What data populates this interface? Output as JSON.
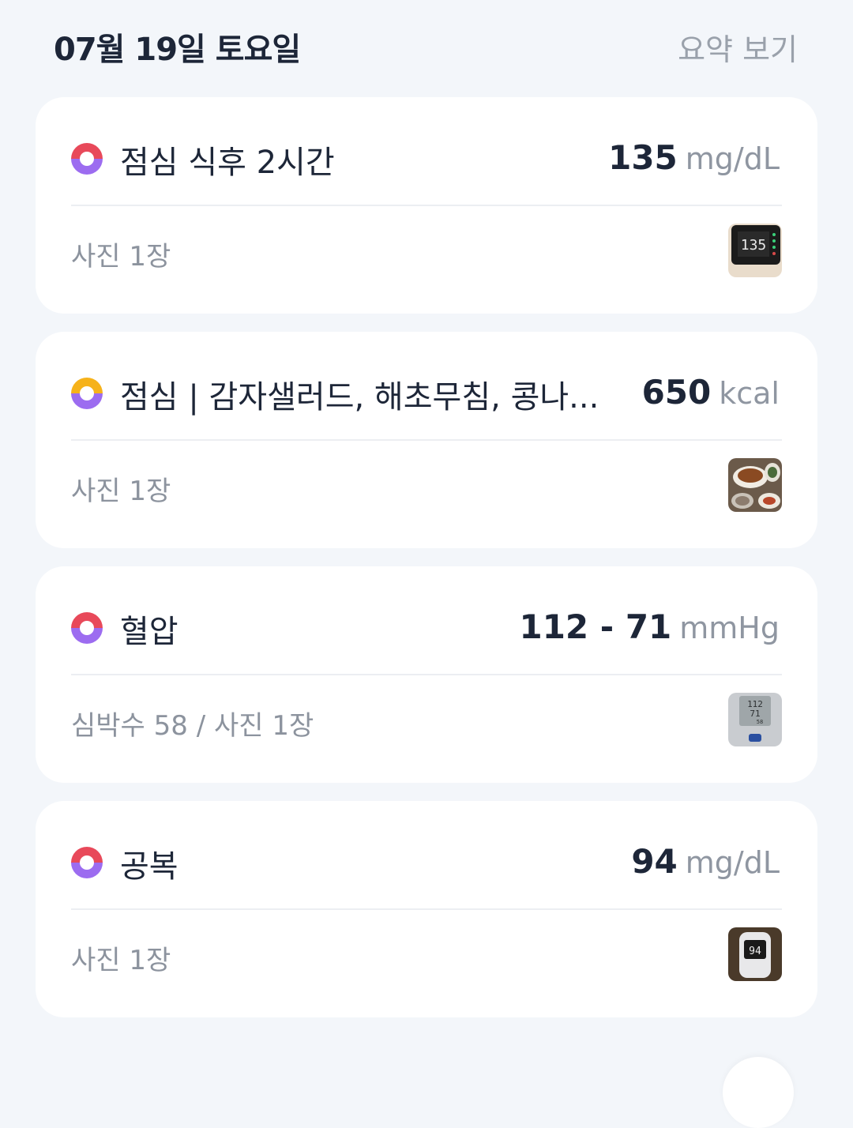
{
  "header": {
    "date": "07월 19일 토요일",
    "summary_link": "요약 보기"
  },
  "entries": [
    {
      "ring": "red",
      "title": "점심 식후 2시간",
      "value": "135",
      "unit": "mg/dL",
      "sub": "사진 1장",
      "thumb_icon": "glucose-meter-photo"
    },
    {
      "ring": "yellow",
      "title": "점심 | 감자샐러드, 해초무침, 콩나...",
      "value": "650",
      "unit": "kcal",
      "sub": "사진 1장",
      "thumb_icon": "meal-photo"
    },
    {
      "ring": "red",
      "title": "혈압",
      "value": "112 - 71",
      "unit": "mmHg",
      "sub": "심박수 58 / 사진 1장",
      "thumb_icon": "blood-pressure-monitor-photo"
    },
    {
      "ring": "red",
      "title": "공복",
      "value": "94",
      "unit": "mg/dL",
      "sub": "사진 1장",
      "thumb_icon": "glucose-meter-photo"
    }
  ],
  "colors": {
    "ring_red": "#e8495a",
    "ring_yellow": "#f6b21a",
    "ring_purple": "#9c6cf0",
    "text_primary": "#1d2638",
    "text_muted": "#8f96a1",
    "background": "#f3f6fa"
  }
}
